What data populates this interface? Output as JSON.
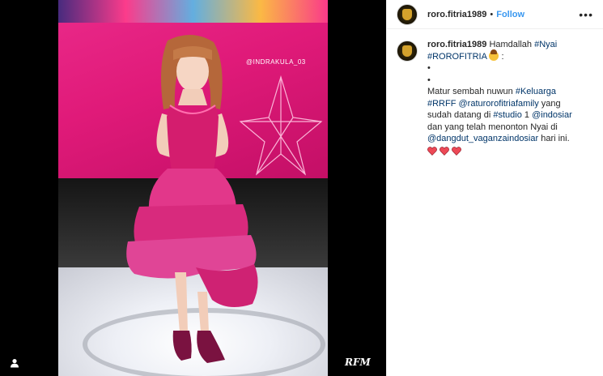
{
  "post": {
    "photo_watermark": "@INDRAKULA_03",
    "photo_signature": "RFM"
  },
  "header": {
    "username": "roro.fitria1989",
    "separator": "•",
    "follow_label": "Follow",
    "more_label": "•••"
  },
  "caption": {
    "username": "roro.fitria1989",
    "line1_text": "Hamdallah ",
    "tag_nyai": "#Nyai",
    "tag_rorofitria": "#ROROFITRIA",
    "line1_end": " :",
    "bullet1": "•",
    "bullet2": "•",
    "text_matur": "Matur sembah nuwun ",
    "tag_keluarga": "#Keluarga",
    "tag_rrff": "#RRFF",
    "mention_family": "@raturorofitriafamily",
    "text_yang": " yang sudah datang di ",
    "tag_studio": "#studio",
    "text_one": " 1 ",
    "mention_indosiar": "@indosiar",
    "text_dan": " dan yang telah menonton Nyai di ",
    "mention_dangdut": "@dangdut_vaganzaindosiar",
    "text_end": " hari ini.",
    "heart_count": 3
  },
  "colors": {
    "link": "#003569",
    "follow": "#3897f0",
    "heart": "#ed4956"
  },
  "icons": [
    "user-tag-icon",
    "more-options-icon",
    "heart-emoji-icon",
    "praying-face-emoji-icon",
    "avatar-crest-icon"
  ]
}
